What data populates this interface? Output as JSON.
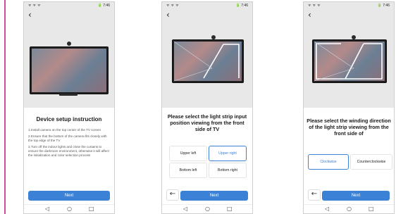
{
  "status_bar": {
    "left": "ᯤ ᯤ ᯤ",
    "right": "🔋 7:46"
  },
  "back_glyph": "‹",
  "nav": {
    "back": "◁",
    "home": "○",
    "recent": "□"
  },
  "screen1": {
    "title": "Device setup instruction",
    "steps": [
      "1.Install camera on the top center of the TV screen",
      "2.Ensure that the bottom of the camera fits closely with the top edge of the TV",
      "3.Turn off the indoor lights and close the curtains to ensure the darkroom environment, otherwise it will affect the initialization and color selection process"
    ],
    "next_label": "Next"
  },
  "screen2": {
    "title": "Please select the light strip input position viewing from the front side of TV",
    "options": [
      "Upper left",
      "Upper right",
      "Bottom left",
      "Bottom right"
    ],
    "selected": "Upper right",
    "back_arrow": "←",
    "next_label": "Next"
  },
  "screen3": {
    "title": "Please select the winding direction of the light strip viewing from the front side of",
    "options": [
      "Clockwise",
      "Counterclockwise"
    ],
    "selected": "Clockwise",
    "back_arrow": "←",
    "next_label": "Next"
  },
  "colors": {
    "accent": "#3b82d6",
    "strip": "#ffffff",
    "border_pink": "#d14a9c"
  }
}
